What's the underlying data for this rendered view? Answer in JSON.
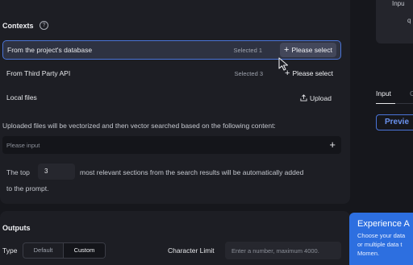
{
  "contexts": {
    "title": "Contexts",
    "help_icon_glyph": "?",
    "rows": [
      {
        "label": "From the project's database",
        "count": "Selected 1",
        "action": "Please select"
      },
      {
        "label": "From Third Party API",
        "count": "Selected 3",
        "action": "Please select"
      },
      {
        "label": "Local files",
        "action": "Upload"
      }
    ],
    "upload_icon": "upload-icon",
    "description": "Uploaded files will be vectorized and then vector searched based on the following content:",
    "search_placeholder": "Please input",
    "top_prefix": "The top",
    "top_value": "3",
    "top_suffix": "most relevant sections from the search results will be automatically added",
    "top_suffix_line2": "to the prompt."
  },
  "outputs": {
    "title": "Outputs",
    "type_label": "Type",
    "type_options": [
      "Default",
      "Custom"
    ],
    "type_selected": "Custom",
    "char_limit_label": "Character Limit",
    "char_limit_placeholder": "Enter a number, maximum 4000."
  },
  "right_panel": {
    "card_text_1": "Inpu",
    "card_text_2": "q",
    "tabs": [
      "Input",
      "C"
    ],
    "active_tab": "Input",
    "preview_label": "Previe"
  },
  "experience": {
    "title": "Experience A",
    "body_lines": [
      "Choose your data",
      "or multiple data t",
      "Momen."
    ]
  },
  "colors": {
    "accent": "#4a74d8",
    "panel": "#1d1e24",
    "background": "#16171c",
    "experience_bg": "#2d6fe0"
  }
}
